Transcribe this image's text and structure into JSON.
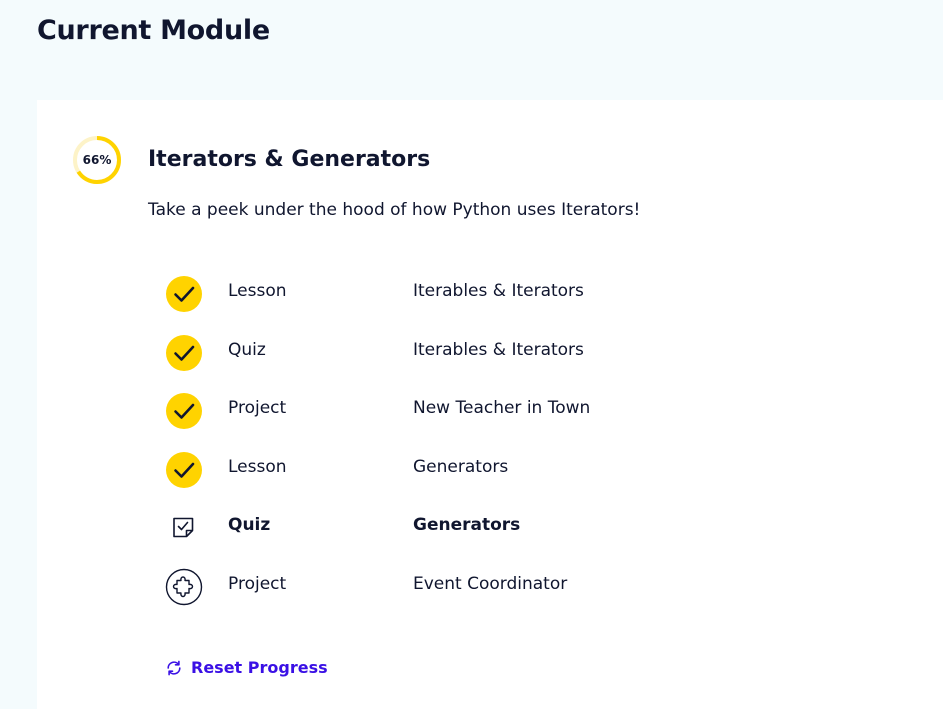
{
  "page": {
    "heading": "Current Module"
  },
  "module": {
    "progress_label": "66%",
    "progress_fraction": 0.66,
    "title": "Iterators & Generators",
    "description": "Take a peek under the hood of how Python uses Iterators!",
    "items": [
      {
        "type": "Lesson",
        "title": "Iterables & Iterators",
        "status": "complete",
        "icon": "check-circle-icon"
      },
      {
        "type": "Quiz",
        "title": "Iterables & Iterators",
        "status": "complete",
        "icon": "check-circle-icon"
      },
      {
        "type": "Project",
        "title": "New Teacher in Town",
        "status": "complete",
        "icon": "check-circle-icon"
      },
      {
        "type": "Lesson",
        "title": "Generators",
        "status": "complete",
        "icon": "check-circle-icon"
      },
      {
        "type": "Quiz",
        "title": "Generators",
        "status": "current",
        "icon": "quiz-icon"
      },
      {
        "type": "Project",
        "title": "Event Coordinator",
        "status": "incomplete",
        "icon": "project-puzzle-icon"
      }
    ],
    "reset_label": "Reset Progress",
    "reset_icon": "refresh-icon"
  },
  "colors": {
    "accent_yellow": "#ffd300",
    "link_blue": "#3a10e5",
    "text_navy": "#10162f",
    "page_bg": "#f4fbfd"
  }
}
